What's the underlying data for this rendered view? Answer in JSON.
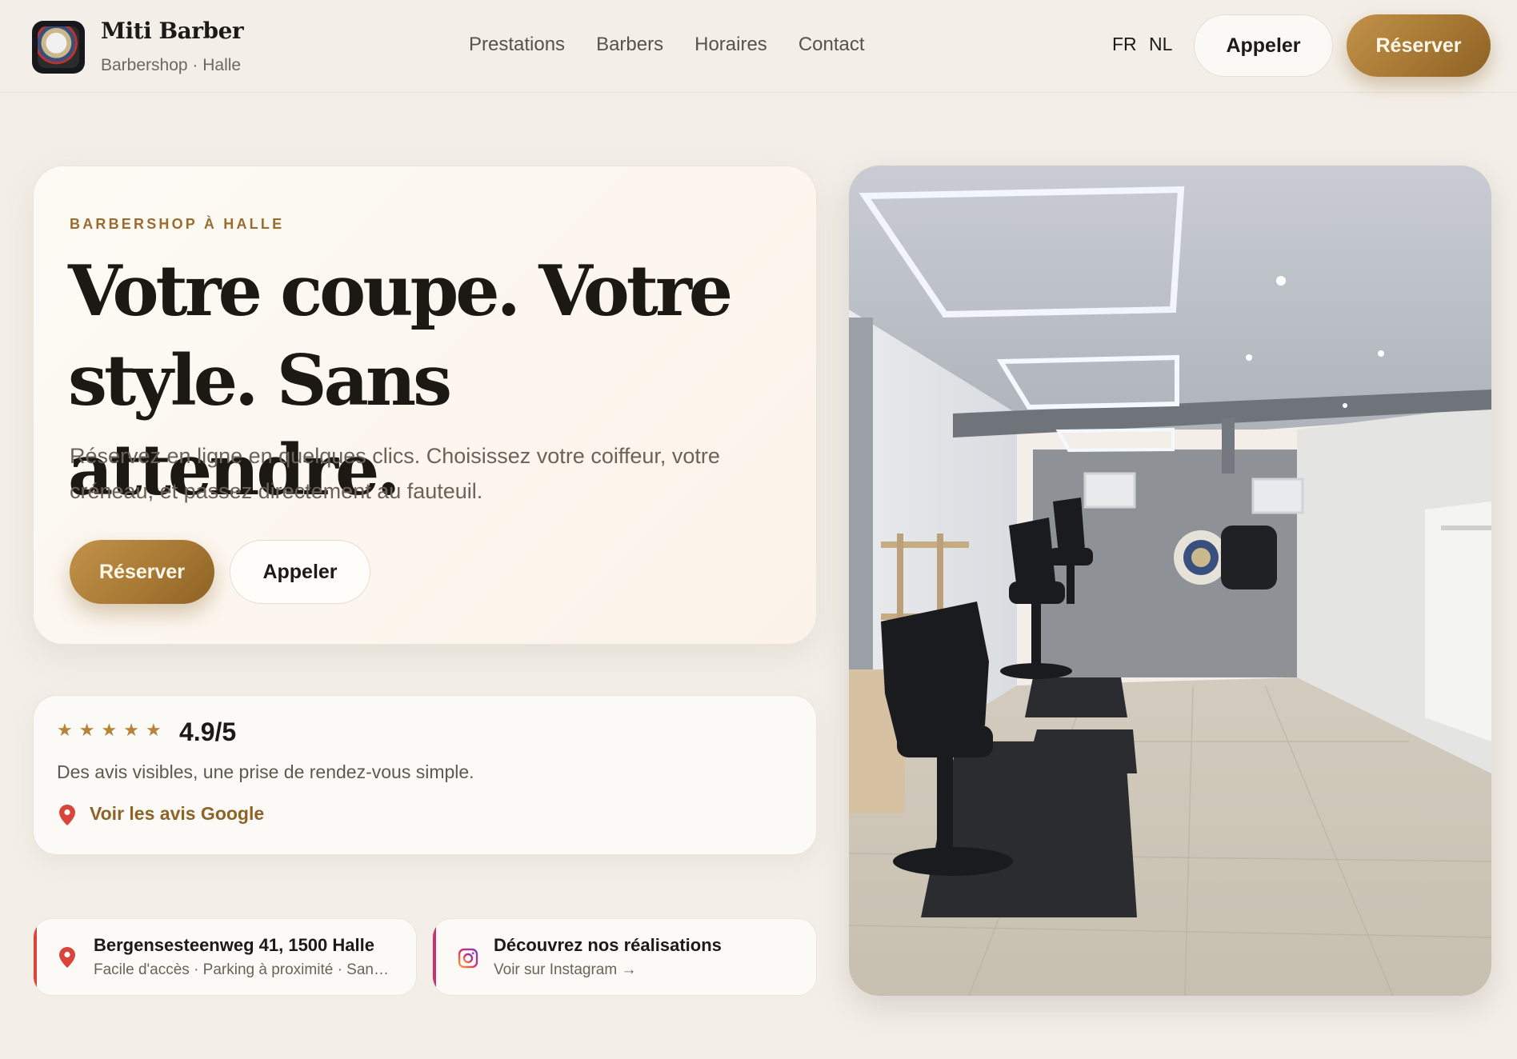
{
  "header": {
    "brand_name": "Miti Barber",
    "brand_sub": "Barbershop · Halle",
    "nav": [
      "Prestations",
      "Barbers",
      "Horaires",
      "Contact"
    ],
    "languages": [
      "FR",
      "NL"
    ],
    "call_label": "Appeler",
    "book_label": "Réserver"
  },
  "hero": {
    "eyebrow": "BARBERSHOP À HALLE",
    "title_line1": "Votre coupe. Votre",
    "title_line2": "style. Sans attendre.",
    "description": "Réservez en ligne en quelques clics. Choisissez votre coiffeur, votre créneau, et passez directement au fauteuil.",
    "book_label": "Réserver",
    "call_label": "Appeler"
  },
  "rating": {
    "stars": 5,
    "score": "4.9/5",
    "text": "Des avis visibles, une prise de rendez-vous simple.",
    "link_label": "Voir les avis Google"
  },
  "address_card": {
    "title": "Bergensesteenweg 41, 1500 Halle",
    "subtitle": "Facile d'accès · Parking à proximité · Sans rendez-vous",
    "icon": "map-pin-icon",
    "accent": "#d9453b"
  },
  "instagram_card": {
    "title": "Découvrez nos réalisations",
    "subtitle": "Voir sur Instagram →",
    "icon": "instagram-icon",
    "accent": "#c8326e"
  },
  "colors": {
    "background": "#f3efe8",
    "accent_gold": "#a97a35",
    "eyebrow": "#9a6c2e",
    "text_dark": "#1c1a17"
  },
  "photo": {
    "icon": "barbershop-interior-photo"
  }
}
